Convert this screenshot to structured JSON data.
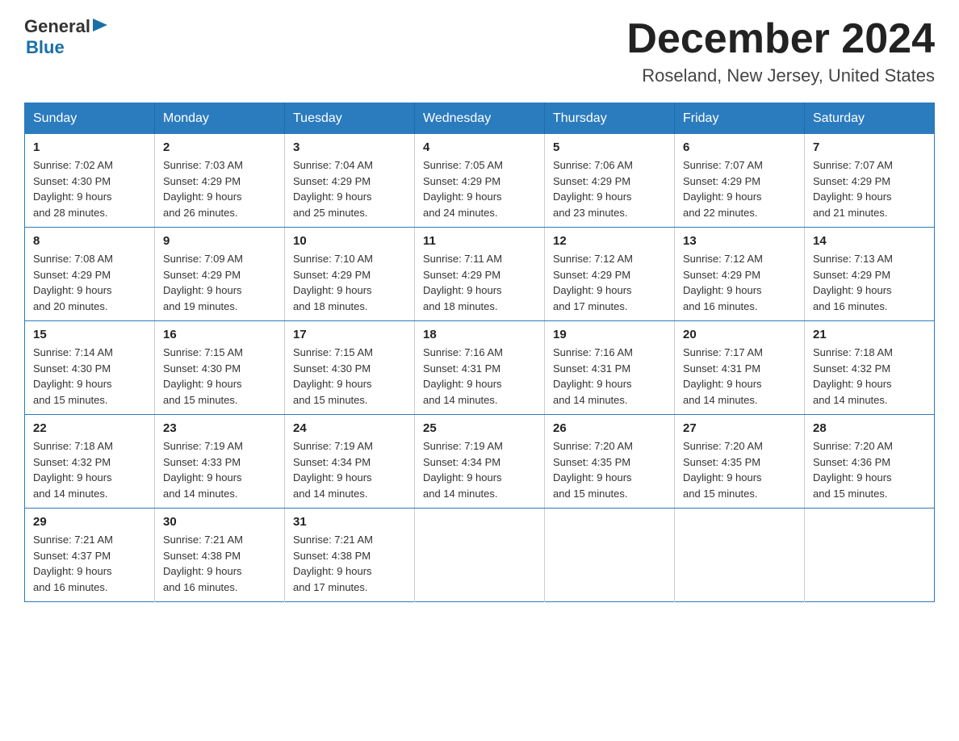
{
  "logo": {
    "general": "General",
    "blue": "Blue"
  },
  "title": {
    "month_year": "December 2024",
    "location": "Roseland, New Jersey, United States"
  },
  "weekdays": [
    "Sunday",
    "Monday",
    "Tuesday",
    "Wednesday",
    "Thursday",
    "Friday",
    "Saturday"
  ],
  "weeks": [
    [
      {
        "day": "1",
        "sunrise": "7:02 AM",
        "sunset": "4:30 PM",
        "daylight": "9 hours and 28 minutes."
      },
      {
        "day": "2",
        "sunrise": "7:03 AM",
        "sunset": "4:29 PM",
        "daylight": "9 hours and 26 minutes."
      },
      {
        "day": "3",
        "sunrise": "7:04 AM",
        "sunset": "4:29 PM",
        "daylight": "9 hours and 25 minutes."
      },
      {
        "day": "4",
        "sunrise": "7:05 AM",
        "sunset": "4:29 PM",
        "daylight": "9 hours and 24 minutes."
      },
      {
        "day": "5",
        "sunrise": "7:06 AM",
        "sunset": "4:29 PM",
        "daylight": "9 hours and 23 minutes."
      },
      {
        "day": "6",
        "sunrise": "7:07 AM",
        "sunset": "4:29 PM",
        "daylight": "9 hours and 22 minutes."
      },
      {
        "day": "7",
        "sunrise": "7:07 AM",
        "sunset": "4:29 PM",
        "daylight": "9 hours and 21 minutes."
      }
    ],
    [
      {
        "day": "8",
        "sunrise": "7:08 AM",
        "sunset": "4:29 PM",
        "daylight": "9 hours and 20 minutes."
      },
      {
        "day": "9",
        "sunrise": "7:09 AM",
        "sunset": "4:29 PM",
        "daylight": "9 hours and 19 minutes."
      },
      {
        "day": "10",
        "sunrise": "7:10 AM",
        "sunset": "4:29 PM",
        "daylight": "9 hours and 18 minutes."
      },
      {
        "day": "11",
        "sunrise": "7:11 AM",
        "sunset": "4:29 PM",
        "daylight": "9 hours and 18 minutes."
      },
      {
        "day": "12",
        "sunrise": "7:12 AM",
        "sunset": "4:29 PM",
        "daylight": "9 hours and 17 minutes."
      },
      {
        "day": "13",
        "sunrise": "7:12 AM",
        "sunset": "4:29 PM",
        "daylight": "9 hours and 16 minutes."
      },
      {
        "day": "14",
        "sunrise": "7:13 AM",
        "sunset": "4:29 PM",
        "daylight": "9 hours and 16 minutes."
      }
    ],
    [
      {
        "day": "15",
        "sunrise": "7:14 AM",
        "sunset": "4:30 PM",
        "daylight": "9 hours and 15 minutes."
      },
      {
        "day": "16",
        "sunrise": "7:15 AM",
        "sunset": "4:30 PM",
        "daylight": "9 hours and 15 minutes."
      },
      {
        "day": "17",
        "sunrise": "7:15 AM",
        "sunset": "4:30 PM",
        "daylight": "9 hours and 15 minutes."
      },
      {
        "day": "18",
        "sunrise": "7:16 AM",
        "sunset": "4:31 PM",
        "daylight": "9 hours and 14 minutes."
      },
      {
        "day": "19",
        "sunrise": "7:16 AM",
        "sunset": "4:31 PM",
        "daylight": "9 hours and 14 minutes."
      },
      {
        "day": "20",
        "sunrise": "7:17 AM",
        "sunset": "4:31 PM",
        "daylight": "9 hours and 14 minutes."
      },
      {
        "day": "21",
        "sunrise": "7:18 AM",
        "sunset": "4:32 PM",
        "daylight": "9 hours and 14 minutes."
      }
    ],
    [
      {
        "day": "22",
        "sunrise": "7:18 AM",
        "sunset": "4:32 PM",
        "daylight": "9 hours and 14 minutes."
      },
      {
        "day": "23",
        "sunrise": "7:19 AM",
        "sunset": "4:33 PM",
        "daylight": "9 hours and 14 minutes."
      },
      {
        "day": "24",
        "sunrise": "7:19 AM",
        "sunset": "4:34 PM",
        "daylight": "9 hours and 14 minutes."
      },
      {
        "day": "25",
        "sunrise": "7:19 AM",
        "sunset": "4:34 PM",
        "daylight": "9 hours and 14 minutes."
      },
      {
        "day": "26",
        "sunrise": "7:20 AM",
        "sunset": "4:35 PM",
        "daylight": "9 hours and 15 minutes."
      },
      {
        "day": "27",
        "sunrise": "7:20 AM",
        "sunset": "4:35 PM",
        "daylight": "9 hours and 15 minutes."
      },
      {
        "day": "28",
        "sunrise": "7:20 AM",
        "sunset": "4:36 PM",
        "daylight": "9 hours and 15 minutes."
      }
    ],
    [
      {
        "day": "29",
        "sunrise": "7:21 AM",
        "sunset": "4:37 PM",
        "daylight": "9 hours and 16 minutes."
      },
      {
        "day": "30",
        "sunrise": "7:21 AM",
        "sunset": "4:38 PM",
        "daylight": "9 hours and 16 minutes."
      },
      {
        "day": "31",
        "sunrise": "7:21 AM",
        "sunset": "4:38 PM",
        "daylight": "9 hours and 17 minutes."
      },
      null,
      null,
      null,
      null
    ]
  ],
  "labels": {
    "sunrise": "Sunrise: ",
    "sunset": "Sunset: ",
    "daylight": "Daylight: "
  }
}
